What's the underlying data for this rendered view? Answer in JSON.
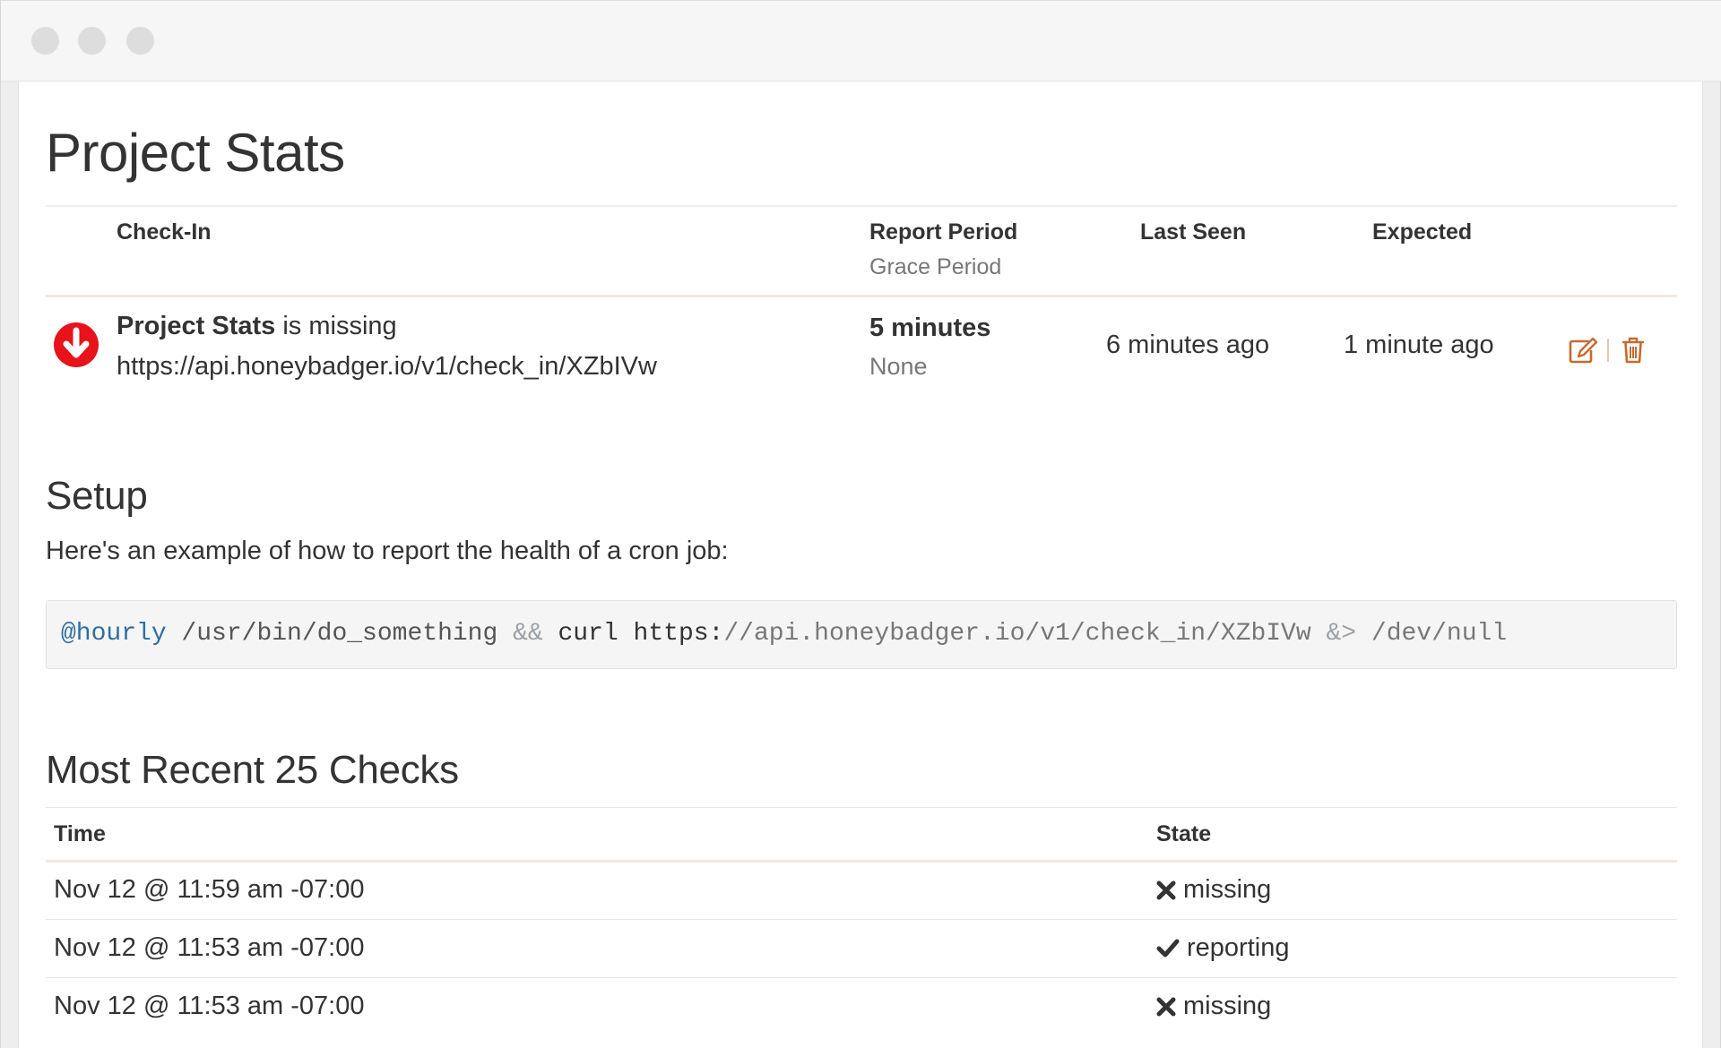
{
  "page": {
    "title": "Project Stats"
  },
  "checkin_table": {
    "headers": {
      "checkin": "Check-In",
      "report_period": "Report Period",
      "grace_period": "Grace Period",
      "last_seen": "Last Seen",
      "expected": "Expected"
    },
    "row": {
      "name": "Project Stats",
      "status_text": " is missing",
      "url": "https://api.honeybadger.io/v1/check_in/XZbIVw",
      "report_period": "5 minutes",
      "grace_period": "None",
      "last_seen": "6 minutes ago",
      "expected": "1 minute ago",
      "status": "missing",
      "status_color": "#e8121a"
    },
    "actions": {
      "edit_icon": "edit-icon",
      "delete_icon": "trash-icon",
      "action_color": "#c66a2e"
    }
  },
  "setup": {
    "title": "Setup",
    "description": "Here's an example of how to report the health of a cron job:",
    "code": {
      "schedule": "@hourly",
      "command_path": " /usr/bin/do_something ",
      "op_and": "&&",
      "curl": " curl ",
      "url_proto": "https:",
      "url_rest": "//api.honeybadger.io/v1/check_in/XZbIVw",
      "redirect": " &> ",
      "null_path": "/dev/null"
    }
  },
  "recent_checks": {
    "title": "Most Recent 25 Checks",
    "headers": {
      "time": "Time",
      "state": "State"
    },
    "rows": [
      {
        "time": "Nov 12 @ 11:59 am -07:00",
        "state": "missing",
        "icon": "x-icon"
      },
      {
        "time": "Nov 12 @ 11:53 am -07:00",
        "state": "reporting",
        "icon": "check-icon"
      },
      {
        "time": "Nov 12 @ 11:53 am -07:00",
        "state": "missing",
        "icon": "x-icon"
      }
    ]
  }
}
